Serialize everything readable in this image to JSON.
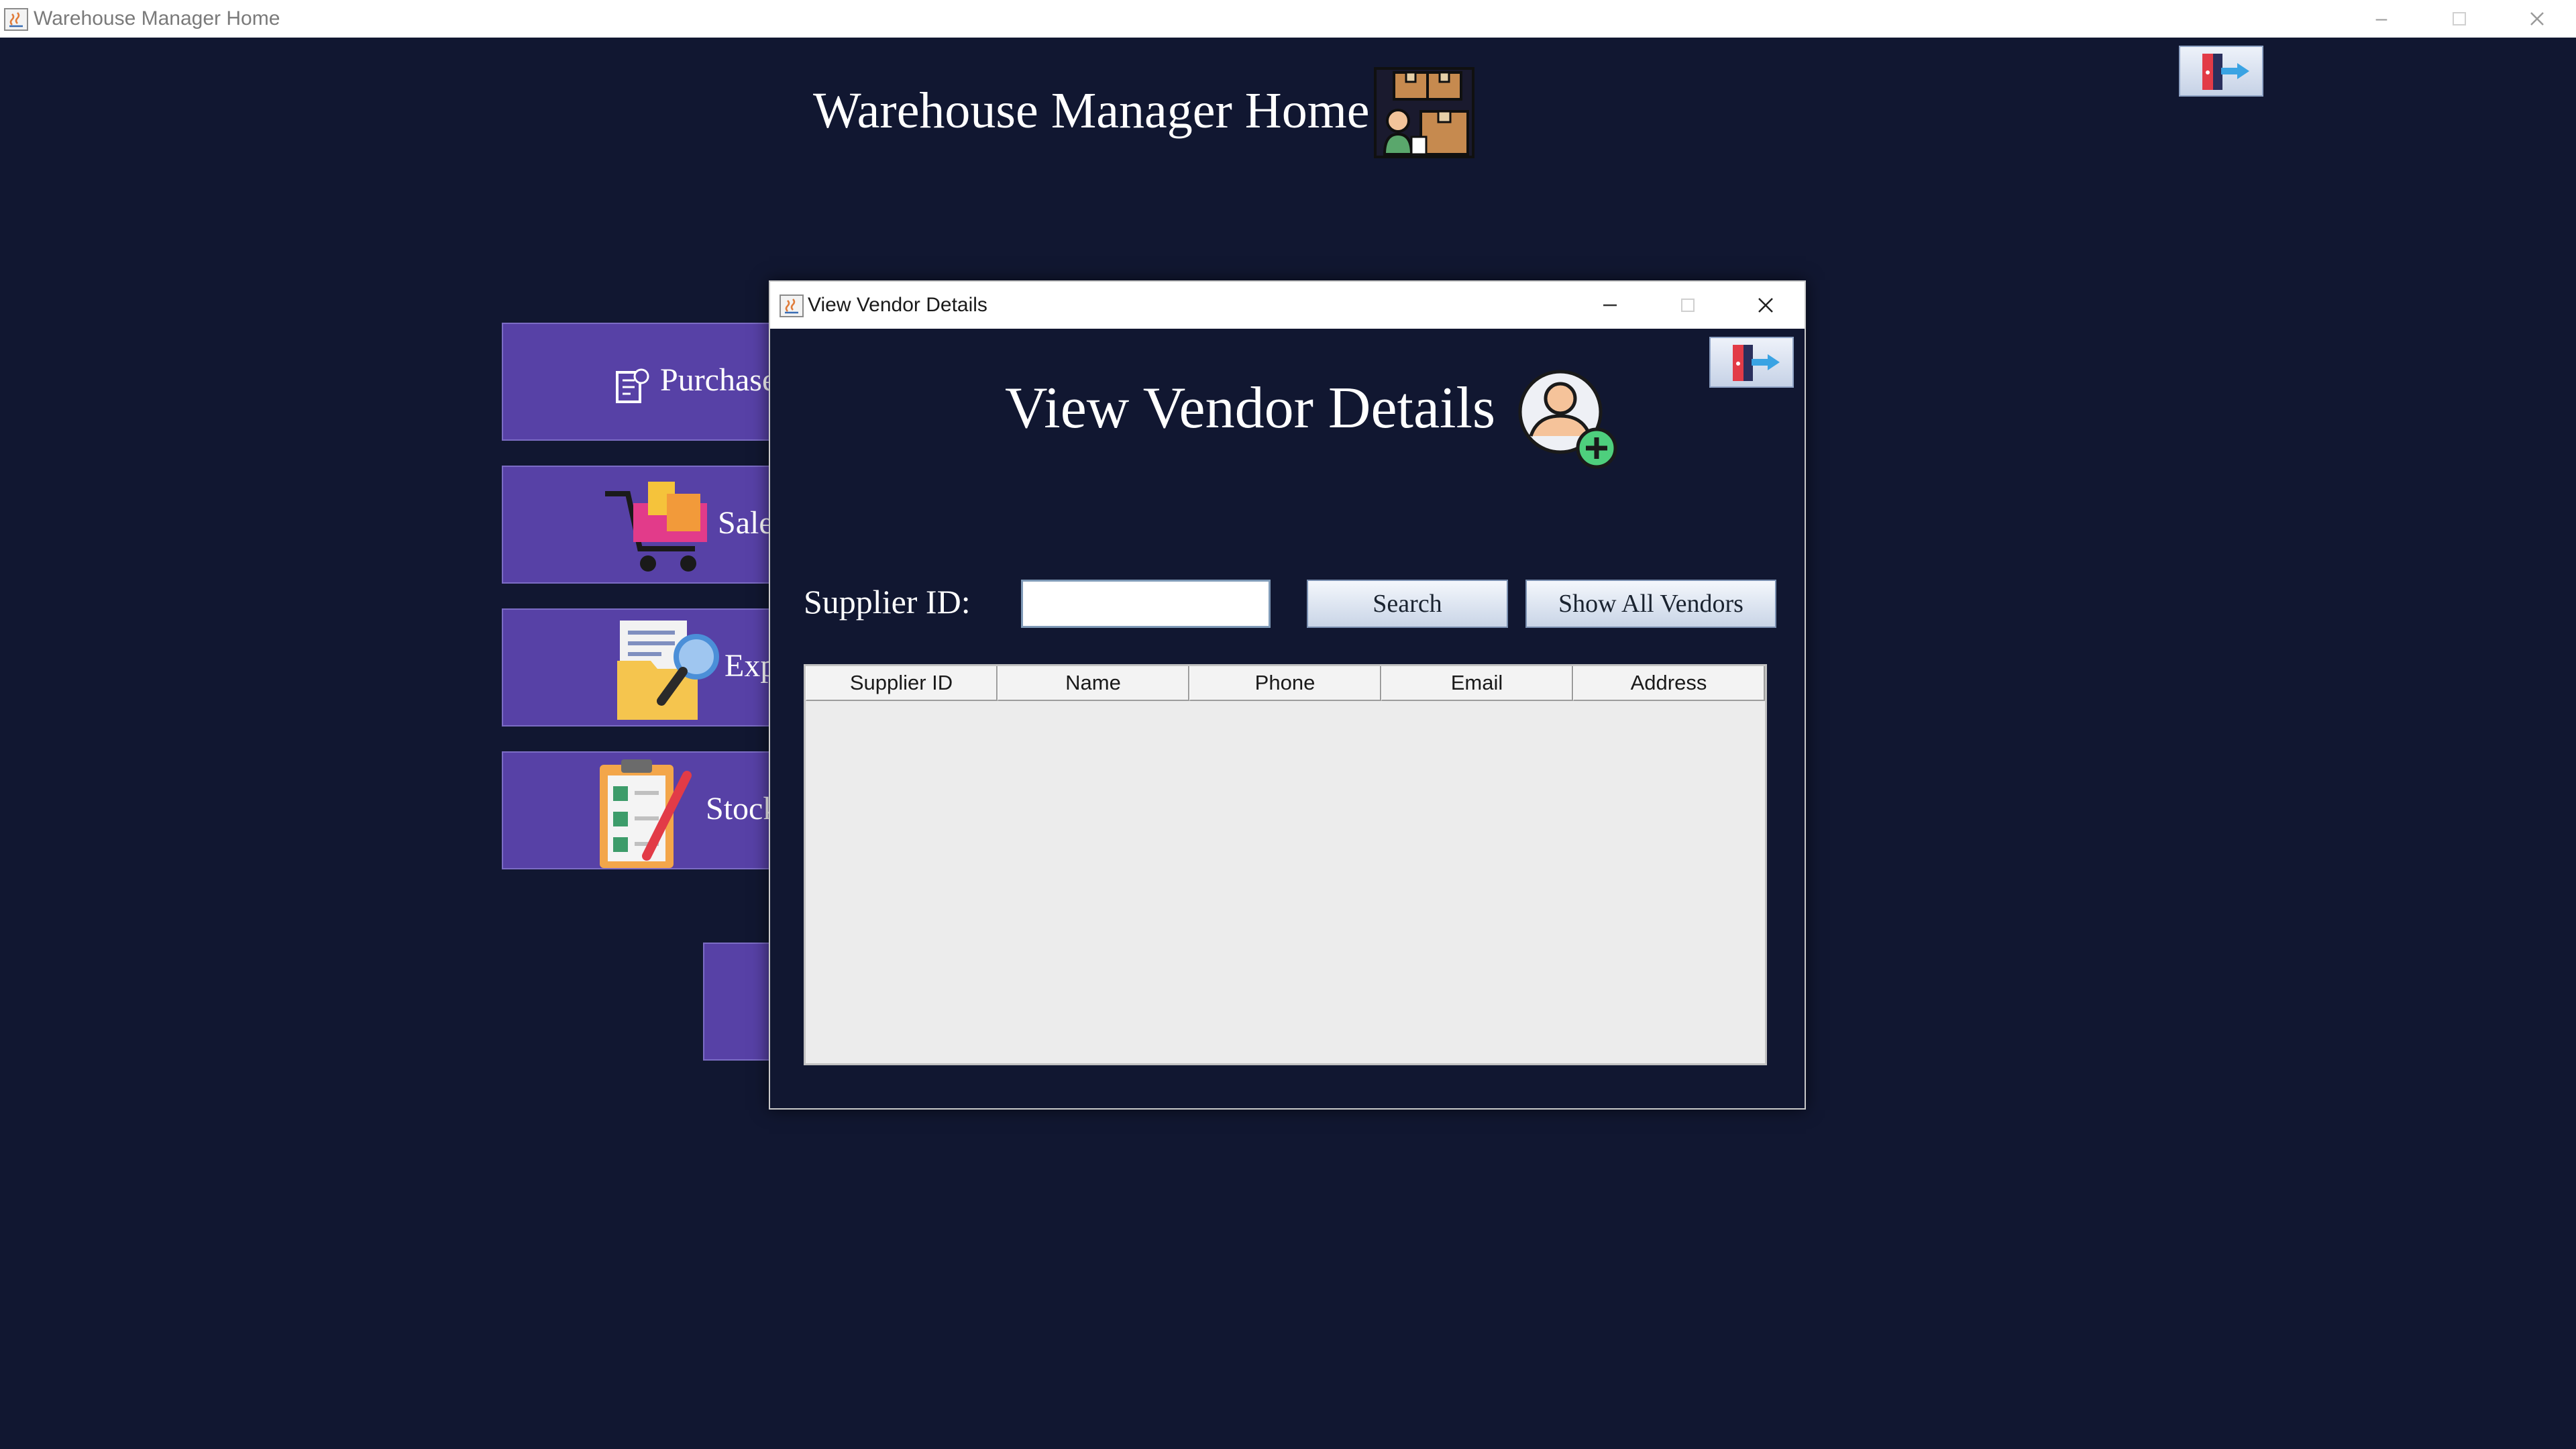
{
  "main_window": {
    "title": "Warehouse Manager Home",
    "heading": "Warehouse Manager Home",
    "heading_icon": "warehouse-boxes-worker-icon",
    "logout_icon": "logout-door-arrow-icon",
    "menu": [
      {
        "label": "Purchase",
        "icon": "purchase-bill-icon"
      },
      {
        "label": "Sales",
        "icon": "shopping-cart-icon"
      },
      {
        "label": "Expenses",
        "icon": "folder-search-icon"
      },
      {
        "label": "Stock",
        "icon": "clipboard-checklist-icon"
      }
    ]
  },
  "dialog": {
    "title": "View Vendor Details",
    "heading": "View Vendor Details",
    "heading_icon": "add-user-icon",
    "logout_icon": "logout-door-arrow-icon",
    "search": {
      "label": "Supplier ID:",
      "value": "",
      "placeholder": "",
      "search_button": "Search",
      "show_all_button": "Show All Vendors"
    },
    "table": {
      "columns": [
        "Supplier ID",
        "Name",
        "Phone",
        "Email",
        "Address"
      ],
      "rows": []
    }
  },
  "colors": {
    "background": "#111731",
    "menu_button": "#5741a6",
    "table_bg": "#ececec"
  }
}
